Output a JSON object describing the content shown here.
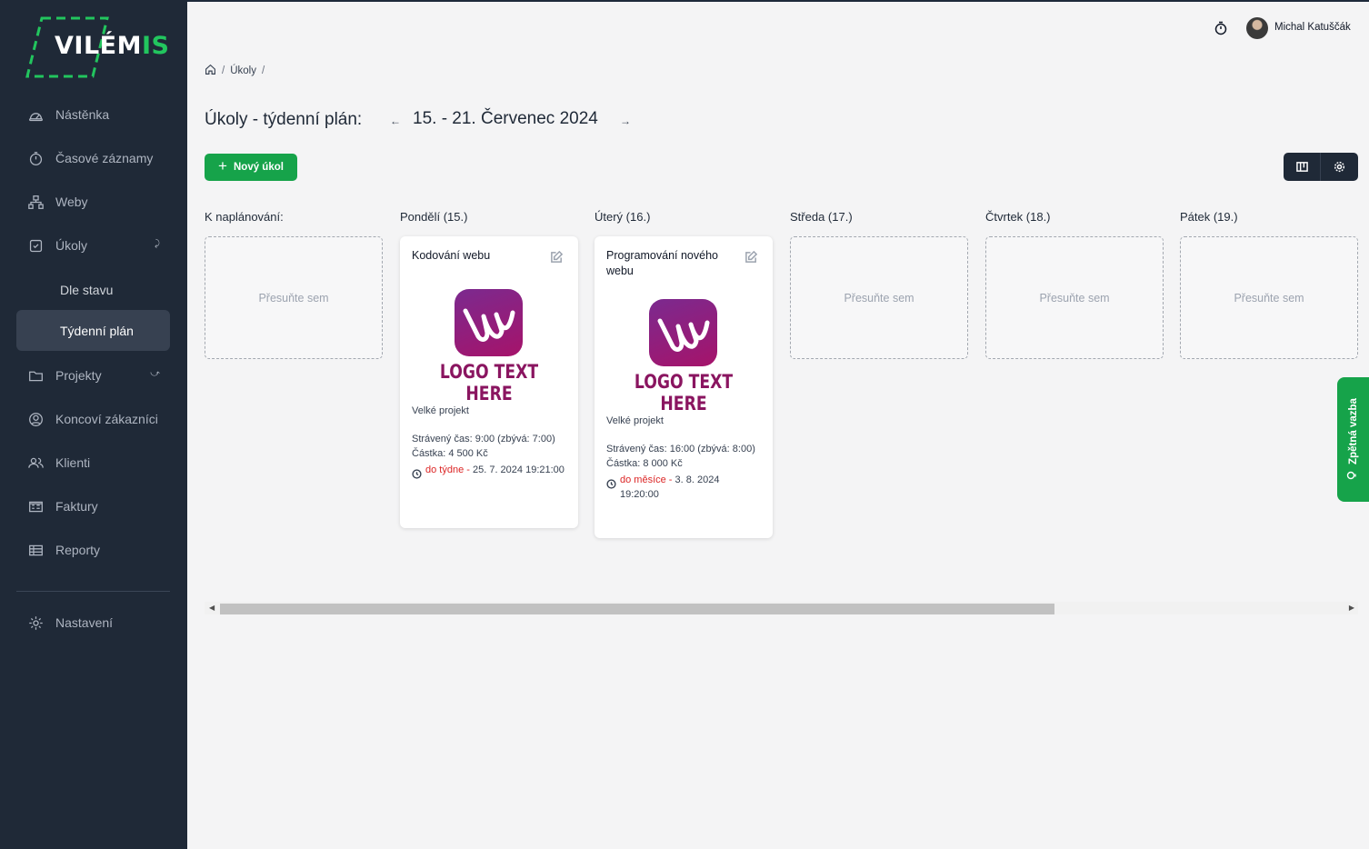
{
  "app": {
    "logo_main": "VILÉM",
    "logo_accent": "IS"
  },
  "sidebar": {
    "items": [
      {
        "label": "Nástěnka",
        "icon": "gauge-icon"
      },
      {
        "label": "Časové záznamy",
        "icon": "stopwatch-icon"
      },
      {
        "label": "Weby",
        "icon": "sitemap-icon"
      },
      {
        "label": "Úkoly",
        "icon": "checkbox-icon"
      },
      {
        "label": "Projekty",
        "icon": "folder-icon"
      },
      {
        "label": "Koncoví zákazníci",
        "icon": "user-circle-icon"
      },
      {
        "label": "Klienti",
        "icon": "users-icon"
      },
      {
        "label": "Faktury",
        "icon": "invoice-icon"
      },
      {
        "label": "Reporty",
        "icon": "table-icon"
      },
      {
        "label": "Nastavení",
        "icon": "gear-icon"
      }
    ],
    "subitems": [
      {
        "label": "Dle stavu"
      },
      {
        "label": "Týdenní plán",
        "active": true
      }
    ]
  },
  "header": {
    "user_name": "Michal Katuščák"
  },
  "breadcrumb": {
    "items": [
      "Úkoly"
    ]
  },
  "page": {
    "title": "Úkoly - týdenní plán:",
    "week_prev": "←",
    "week_label": "15. - 21. Červenec 2024",
    "week_next": "→",
    "new_task_label": "Nový úkol"
  },
  "board": {
    "dropzone_text": "Přesuňte sem",
    "columns": [
      {
        "title": "K naplánování:"
      },
      {
        "title": "Pondělí (15.)"
      },
      {
        "title": "Úterý (16.)"
      },
      {
        "title": "Středa (17.)"
      },
      {
        "title": "Čtvrtek (18.)"
      },
      {
        "title": "Pátek (19.)"
      }
    ],
    "cards": [
      {
        "title": "Kodování webu",
        "logo_text": "LOGO TEXT HERE",
        "project": "Velké projekt",
        "time_spent": "Strávený čas: 9:00  (zbývá: 7:00)",
        "amount": "Částka: 4 500 Kč",
        "due_label": "do týdne",
        "due_sep": " - ",
        "due_date": "25. 7. 2024 19:21:00"
      },
      {
        "title": "Programování nového webu",
        "logo_text": "LOGO TEXT HERE",
        "project": "Velké projekt",
        "time_spent": "Strávený čas: 16:00  (zbývá: 8:00)",
        "amount": "Částka: 8 000 Kč",
        "due_label": "do měsíce",
        "due_sep": " - ",
        "due_date": "3. 8. 2024 19:20:00"
      }
    ]
  },
  "feedback": {
    "label": "Zpětná vazba"
  },
  "colors": {
    "sidebar_bg": "#1f2937",
    "accent_green": "#16a34a",
    "due_red": "#dc2626"
  }
}
